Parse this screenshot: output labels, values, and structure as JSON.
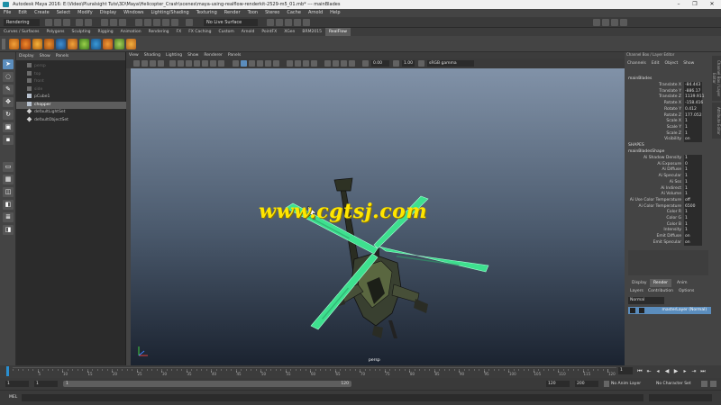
{
  "title": "Autodesk Maya 2016: E:\\Video\\Pluralsight Tuts\\3D\\Maya\\Helicopter_Crash\\scenes\\maya-using-realflow-renderkit-2529-m5_01.mb* --- mainBlades",
  "menus": [
    "File",
    "Edit",
    "Create",
    "Select",
    "Modify",
    "Display",
    "Windows",
    "Lighting/Shading",
    "Texturing",
    "Render",
    "Toon",
    "Stereo",
    "Cache",
    "Arnold",
    "Help"
  ],
  "status": {
    "mode": "Rendering",
    "live_surface": "No Live Surface"
  },
  "shelf_tabs": [
    "Curves / Surfaces",
    "Polygons",
    "Sculpting",
    "Rigging",
    "Animation",
    "Rendering",
    "FX",
    "FX Caching",
    "Custom",
    "Arnold",
    "PointFX",
    "XGen",
    "BRM2015",
    "RealFlow"
  ],
  "shelf_active": "RealFlow",
  "outliner": {
    "menu": [
      "Display",
      "Show",
      "Panels"
    ],
    "items": [
      {
        "label": "persp",
        "kind": "cam",
        "dim": true
      },
      {
        "label": "top",
        "kind": "cam",
        "dim": true
      },
      {
        "label": "front",
        "kind": "cam",
        "dim": true
      },
      {
        "label": "side",
        "kind": "cam",
        "dim": true
      },
      {
        "label": "pCube1",
        "kind": "geo",
        "dim": false
      },
      {
        "label": "chopper",
        "kind": "geo",
        "dim": false
      },
      {
        "label": "defaultLightSet",
        "kind": "set",
        "dim": false
      },
      {
        "label": "defaultObjectSet",
        "kind": "set",
        "dim": false
      }
    ]
  },
  "viewport": {
    "menu": [
      "View",
      "Shading",
      "Lighting",
      "Show",
      "Renderer",
      "Panels"
    ],
    "field1": "0.00",
    "field2": "1.00",
    "color_mgmt": "sRGB gamma",
    "camera": "persp",
    "watermark": "www.cgtsj.com"
  },
  "channelbox": {
    "menu": [
      "Channels",
      "Edit",
      "Object",
      "Show"
    ],
    "header": "Channel Box / Layer Editor",
    "object": "mainBlades",
    "channels": [
      {
        "label": "Translate X",
        "value": "-84.443"
      },
      {
        "label": "Translate Y",
        "value": "-886.17"
      },
      {
        "label": "Translate Z",
        "value": "1139.911"
      },
      {
        "label": "Rotate X",
        "value": "-158.416"
      },
      {
        "label": "Rotate Y",
        "value": "0.412"
      },
      {
        "label": "Rotate Z",
        "value": "177.052"
      },
      {
        "label": "Scale X",
        "value": "1"
      },
      {
        "label": "Scale Y",
        "value": "1"
      },
      {
        "label": "Scale Z",
        "value": "1"
      },
      {
        "label": "Visibility",
        "value": "on"
      }
    ],
    "shapes_label": "SHAPES",
    "shape_name": "mainBladesShape",
    "shape_attrs": [
      {
        "label": "Ai Shadow Density",
        "value": "1"
      },
      {
        "label": "Ai Exposure",
        "value": "0"
      },
      {
        "label": "Ai Diffuse",
        "value": "1"
      },
      {
        "label": "Ai Specular",
        "value": "1"
      },
      {
        "label": "Ai Sss",
        "value": "1"
      },
      {
        "label": "Ai Indirect",
        "value": "1"
      },
      {
        "label": "Ai Volume",
        "value": "1"
      },
      {
        "label": "Ai Use Color Temperature",
        "value": "off"
      },
      {
        "label": "Ai Color Temperature",
        "value": "6500"
      },
      {
        "label": "Color R",
        "value": "1"
      },
      {
        "label": "Color G",
        "value": "1"
      },
      {
        "label": "Color B",
        "value": "1"
      },
      {
        "label": "Intensity",
        "value": "1"
      },
      {
        "label": "Emit Diffuse",
        "value": "on"
      },
      {
        "label": "Emit Specular",
        "value": "on"
      }
    ],
    "side_tabs": [
      "Channel Box / Layer Editor",
      "Attribute Editor"
    ],
    "layer_tabs": [
      "Display",
      "Render",
      "Anim"
    ],
    "layer_active": "Render",
    "layer_menu": [
      "Layers",
      "Contribution",
      "Options"
    ],
    "layer_mode": "Normal",
    "render_layer": "masterLayer (Normal)"
  },
  "timeline": {
    "ticks": [
      "5",
      "10",
      "15",
      "20",
      "25",
      "30",
      "35",
      "40",
      "45",
      "50",
      "55",
      "60",
      "65",
      "70",
      "75",
      "80",
      "85",
      "90",
      "95",
      "100",
      "105",
      "110",
      "115",
      "120"
    ],
    "current_frame": "1"
  },
  "range": {
    "start": "1",
    "playback_start": "1",
    "range_label": "1",
    "range_end_label": "120",
    "playback_end": "120",
    "end": "200",
    "anim_layer": "No Anim Layer",
    "char_set": "No Character Set"
  },
  "cmd": {
    "label": "MEL"
  }
}
